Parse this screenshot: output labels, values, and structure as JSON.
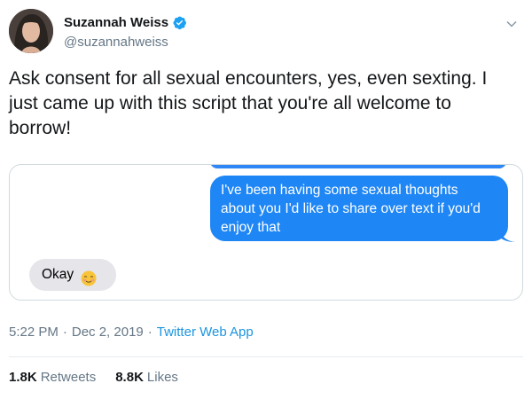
{
  "tweet": {
    "author": {
      "name": "Suzannah Weiss",
      "handle": "@suzannahweiss",
      "avatar_icon": "profile-photo",
      "verified": true
    },
    "text": "Ask consent for all sexual encounters, yes, even sexting. I just came up with this script that you're all welcome to borrow!",
    "media": {
      "outgoing_message": "I've been having some sexual thoughts about you I'd like to share over text if you'd enjoy that",
      "incoming_message": "Okay",
      "incoming_emoji": "smiling-face-with-blush-emoji"
    },
    "time": "5:22 PM",
    "date": "Dec 2, 2019",
    "separator": "·",
    "source": "Twitter Web App",
    "retweets_count": "1.8K",
    "retweets_label": "Retweets",
    "likes_count": "8.8K",
    "likes_label": "Likes"
  },
  "colors": {
    "link_blue": "#1b95e0",
    "imessage_blue": "#1e86f5",
    "imessage_gray": "#e5e5ea",
    "muted_text": "#657786"
  }
}
